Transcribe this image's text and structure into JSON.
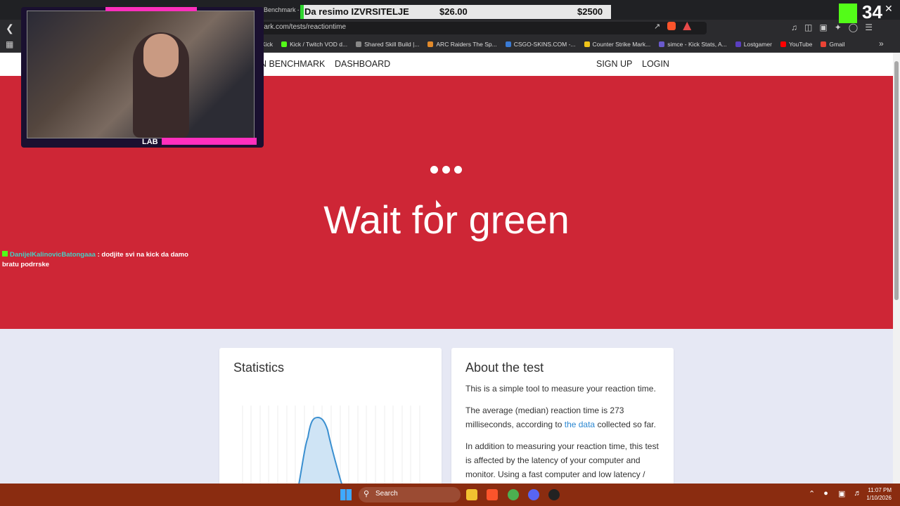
{
  "browser": {
    "tab_partial": "man Benchmark -",
    "url": "mark.com/tests/reactiontime",
    "bookmarks": [
      "Kick",
      "Kick / Twitch VOD d...",
      "Shared Skill Build |...",
      "ARC Raiders The Sp...",
      "CSGO-SKINS.COM -...",
      "Counter Strike Mark...",
      "simce - Kick Stats, A...",
      "Lostgamer",
      "YouTube",
      "Gmail"
    ],
    "bookmark_colors": [
      "#444",
      "#53fc18",
      "#888",
      "#e28a2b",
      "#3a7bd5",
      "#f0c419",
      "#6a5acd",
      "#5a3fc0",
      "#ff0000",
      "#ea4335"
    ]
  },
  "site_nav": {
    "brand_partial": "N BENCHMARK",
    "dashboard": "DASHBOARD",
    "signup": "SIGN UP",
    "login": "LOGIN"
  },
  "hero": {
    "title": "Wait for green",
    "bg_color": "#ce2636"
  },
  "stats": {
    "title": "Statistics"
  },
  "about": {
    "title": "About the test",
    "p1": "This is a simple tool to measure your reaction time.",
    "p2_a": "The average (median) reaction time is 273 milliseconds, according to ",
    "p2_link": "the data",
    "p2_b": " collected so far.",
    "p3": "In addition to measuring your reaction time, this test is affected by the latency of your computer and monitor. Using a fast computer and low latency /"
  },
  "overlay": {
    "banner_text": "Da resimo IZVRSITELJE",
    "banner_amount1": "$26.00",
    "banner_amount2": "$2500",
    "viewer_count": "34",
    "lab_text": "LAB",
    "chat_user": "DanijelKalinovicBatongaaa",
    "chat_message": " : dodjite svi na kick da damo bratu podrrske"
  },
  "taskbar": {
    "search": "Search",
    "time": "11:07 PM",
    "date": "1/10/2026"
  }
}
